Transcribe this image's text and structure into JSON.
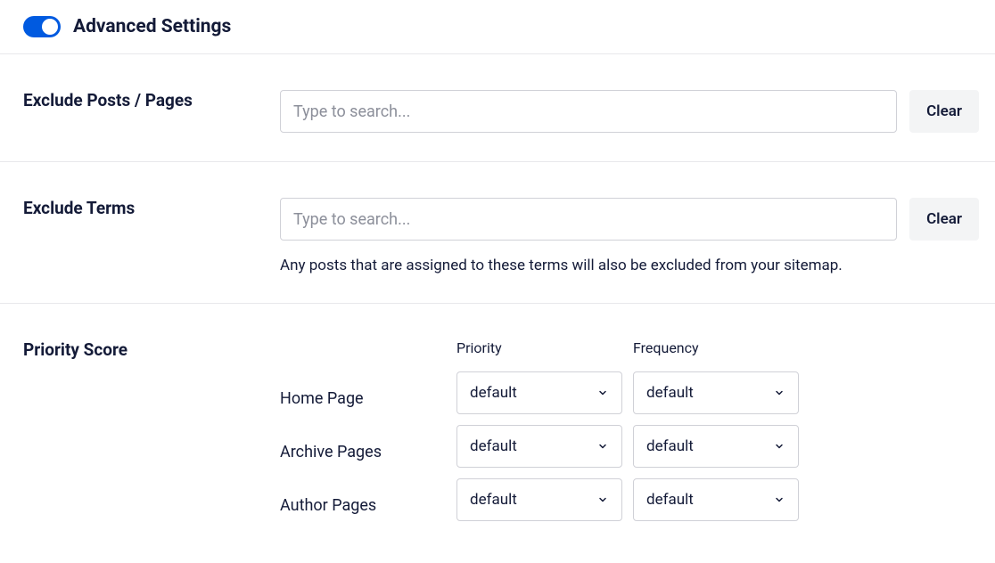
{
  "header": {
    "title": "Advanced Settings",
    "toggle_on": true
  },
  "exclude_posts": {
    "label": "Exclude Posts / Pages",
    "placeholder": "Type to search...",
    "clear": "Clear"
  },
  "exclude_terms": {
    "label": "Exclude Terms",
    "placeholder": "Type to search...",
    "clear": "Clear",
    "helper": "Any posts that are assigned to these terms will also be excluded from your sitemap."
  },
  "priority": {
    "label": "Priority Score",
    "col_priority": "Priority",
    "col_frequency": "Frequency",
    "rows": [
      {
        "label": "Home Page",
        "priority": "default",
        "frequency": "default"
      },
      {
        "label": "Archive Pages",
        "priority": "default",
        "frequency": "default"
      },
      {
        "label": "Author Pages",
        "priority": "default",
        "frequency": "default"
      }
    ]
  }
}
